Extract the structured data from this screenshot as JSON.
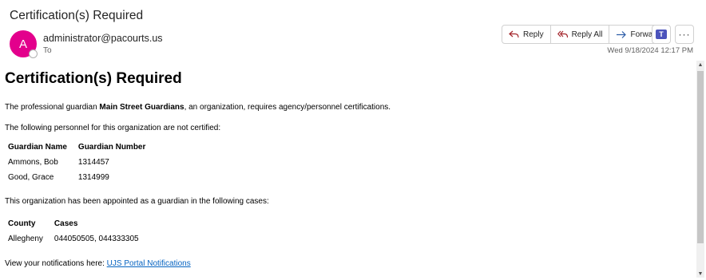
{
  "email": {
    "subject": "Certification(s) Required",
    "avatar_initial": "A",
    "sender": "administrator@pacourts.us",
    "to_label": "To",
    "timestamp": "Wed 9/18/2024 12:17 PM"
  },
  "actions": {
    "reply": "Reply",
    "reply_all": "Reply All",
    "forward": "Forward",
    "more": "···",
    "teams_icon": "teams-icon"
  },
  "body": {
    "heading": "Certification(s) Required",
    "intro_prefix": "The professional guardian ",
    "org_name": "Main Street Guardians",
    "intro_suffix": ", an organization, requires agency/personnel certifications.",
    "personnel_intro": "The following personnel for this organization are not certified:",
    "personnel_table": {
      "headers": [
        "Guardian Name",
        "Guardian Number"
      ],
      "rows": [
        [
          "Ammons, Bob",
          "1314457"
        ],
        [
          "Good, Grace",
          "1314999"
        ]
      ]
    },
    "cases_intro": "This organization has been appointed as a guardian in the following cases:",
    "cases_table": {
      "headers": [
        "County",
        "Cases"
      ],
      "rows": [
        [
          "Allegheny",
          "044050505, 044333305"
        ]
      ]
    },
    "notif_prefix": "View your notifications here: ",
    "notif_link": "UJS Portal Notifications"
  },
  "colors": {
    "avatar": "#e3008c",
    "link": "#0563c1",
    "teams": "#4b53bc"
  }
}
